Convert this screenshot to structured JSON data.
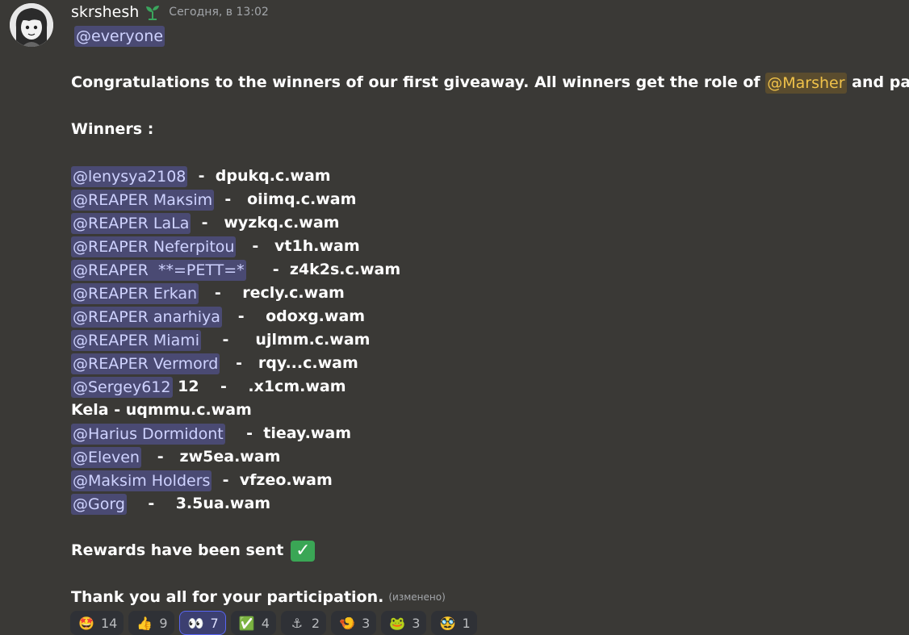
{
  "message": {
    "username": "skrshesh",
    "timestamp": "Сегодня, в 13:02",
    "everyone": "@everyone",
    "congrats_text": "Congratulations to the winners of our first giveaway. All winners get the role of ",
    "role_mention": "@Marsher",
    "congrats_tail": " and pass.",
    "winners_title": "Winners :",
    "winners": [
      {
        "mention": "@lenysya2108",
        "rest": "  -  dpukq.c.wam"
      },
      {
        "mention": "@REAPER Макsim",
        "rest": "  -   oiimq.c.wam"
      },
      {
        "mention": "@REAPER LaLa",
        "rest": "  -   wyzkq.c.wam"
      },
      {
        "mention": "@REAPER Neferpitou",
        "rest": "   -   vt1h.wam"
      },
      {
        "mention": "@REAPER  **=PETT=*",
        "rest": "     -  z4k2s.c.wam"
      },
      {
        "mention": "@REAPER Erkan",
        "rest": "   -    recly.c.wam"
      },
      {
        "mention": "@REAPER anarhiya",
        "rest": "   -    odoxg.wam"
      },
      {
        "mention": "@REAPER Miami",
        "rest": "    -     ujlmm.c.wam"
      },
      {
        "mention": "@REAPER Vermord",
        "rest": "   -   rqy...c.wam"
      },
      {
        "mention": "@Sergey612",
        "rest": " 12    -    .x1cm.wam"
      },
      {
        "mention": "",
        "rest": "Kela - uqmmu.c.wam"
      },
      {
        "mention": "@Harius Dormidont",
        "rest": "    -  tieay.wam"
      },
      {
        "mention": "@Eleven",
        "rest": "   -   zw5ea.wam"
      },
      {
        "mention": "@Maksim Holders",
        "rest": "  -  vfzeo.wam"
      },
      {
        "mention": "@Gorg",
        "rest": "    -    3.5ua.wam"
      }
    ],
    "rewards_text": "Rewards have been sent",
    "thanks_text": "Thank you all for your participation.",
    "edited_label": "(изменено)"
  },
  "reactions": [
    {
      "emoji": "🤩",
      "count": "14",
      "icon": "star-struck-icon"
    },
    {
      "emoji": "👍",
      "count": "9",
      "icon": "thumbs-up-icon"
    },
    {
      "emoji": "👀",
      "count": "7",
      "icon": "eyes-icon",
      "active": true
    },
    {
      "emoji": "✅",
      "count": "4",
      "icon": "check-mark-icon"
    },
    {
      "emoji": "⚓",
      "count": "2",
      "icon": "anchor-icon"
    },
    {
      "emoji": "🍤",
      "count": "3",
      "icon": "custom-emoji-icon"
    },
    {
      "emoji": "🐸",
      "count": "3",
      "icon": "frog-emoji-icon"
    },
    {
      "emoji": "🥸",
      "count": "1",
      "icon": "face-emoji-icon"
    }
  ],
  "colors": {
    "background": "#3a3936",
    "mention_bg": "#4a4a73",
    "mention_text": "#cfd3ff",
    "role_text": "#f0c24a",
    "check_green": "#3aa655"
  }
}
